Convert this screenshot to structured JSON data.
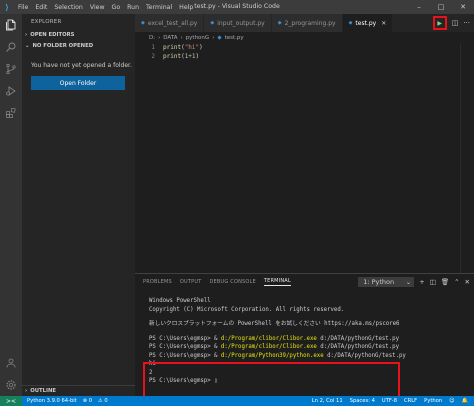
{
  "window": {
    "title": "test.py - Visual Studio Code",
    "menu": [
      "File",
      "Edit",
      "Selection",
      "View",
      "Go",
      "Run",
      "Terminal",
      "Help"
    ],
    "controls": [
      "–",
      "□",
      "✕"
    ]
  },
  "sidebar": {
    "header": "EXPLORER",
    "open_editors": "OPEN EDITORS",
    "no_folder": "NO FOLDER OPENED",
    "message": "You have not yet opened a folder.",
    "open_folder_button": "Open Folder",
    "outline": "OUTLINE"
  },
  "tabs": [
    {
      "label": "excel_test_all.py",
      "active": false
    },
    {
      "label": "input_output.py",
      "active": false
    },
    {
      "label": "2_programing.py",
      "active": false
    },
    {
      "label": "test.py",
      "active": true
    }
  ],
  "breadcrumb": [
    "D:",
    "DATA",
    "pythonG",
    "test.py"
  ],
  "editor": {
    "lines": [
      {
        "num": "1",
        "fn": "print",
        "open": "(",
        "arg": "\"hi\"",
        "close": ")"
      },
      {
        "num": "2",
        "fn": "print",
        "open": "(",
        "arg": "1+1",
        "close": ")"
      }
    ]
  },
  "panel": {
    "tabs": [
      "PROBLEMS",
      "OUTPUT",
      "DEBUG CONSOLE",
      "TERMINAL"
    ],
    "active_tab": "TERMINAL",
    "terminal_select": "1: Python",
    "lines": [
      {
        "prompt": "",
        "cmd": "",
        "text": "Windows PowerShell"
      },
      {
        "prompt": "",
        "cmd": "",
        "text": "Copyright (C) Microsoft Corporation. All rights reserved."
      },
      {
        "prompt": "",
        "cmd": "",
        "text": ""
      },
      {
        "prompt": "",
        "cmd": "",
        "text": "新しいクロスプラットフォームの PowerShell をお試しください https://aka.ms/pscore6"
      },
      {
        "prompt": "",
        "cmd": "",
        "text": ""
      },
      {
        "prompt": "PS C:\\Users\\egmsp> & ",
        "cmd": "d:/Program/clibor/Clibor.exe",
        "text": " d:/DATA/pythonG/test.py"
      },
      {
        "prompt": "PS C:\\Users\\egmsp> & ",
        "cmd": "d:/Program/clibor/Clibor.exe",
        "text": " d:/DATA/pythonG/test.py"
      },
      {
        "prompt": "PS C:\\Users\\egmsp> & ",
        "cmd": "d:/Program/Python39/python.exe",
        "text": " d:/DATA/pythonG/test.py"
      },
      {
        "prompt": "",
        "cmd": "",
        "text": "hi"
      },
      {
        "prompt": "",
        "cmd": "",
        "text": "2"
      },
      {
        "prompt": "",
        "cmd": "",
        "text": "PS C:\\Users\\egmsp> "
      }
    ]
  },
  "statusbar": {
    "remote": "><",
    "python": "Python 3.9.0 64-bit",
    "errors": "⊗ 0",
    "warnings": "⚠ 0",
    "position": "Ln 2, Col 11",
    "spaces": "Spaces: 4",
    "encoding": "UTF-8",
    "eol": "CRLF",
    "language": "Python"
  },
  "colors": {
    "accent": "#007acc",
    "highlight_box": "#e8121c",
    "open_folder_button": "#0e639c"
  }
}
